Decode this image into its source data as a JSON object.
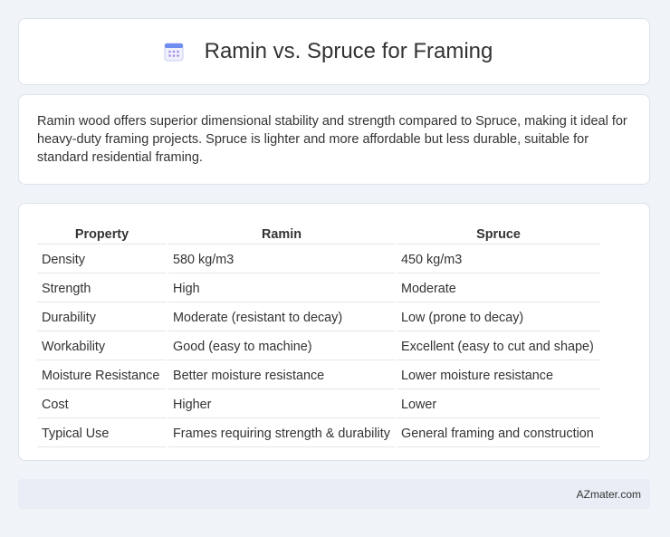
{
  "header": {
    "title": "Ramin vs. Spruce for Framing",
    "icon": "calendar-icon"
  },
  "summary": {
    "text": "Ramin wood offers superior dimensional stability and strength compared to Spruce, making it ideal for heavy-duty framing projects. Spruce is lighter and more affordable but less durable, suitable for standard residential framing."
  },
  "table": {
    "columns": [
      "Property",
      "Ramin",
      "Spruce"
    ],
    "rows": [
      [
        "Density",
        "580 kg/m3",
        "450 kg/m3"
      ],
      [
        "Strength",
        "High",
        "Moderate"
      ],
      [
        "Durability",
        "Moderate (resistant to decay)",
        "Low (prone to decay)"
      ],
      [
        "Workability",
        "Good (easy to machine)",
        "Excellent (easy to cut and shape)"
      ],
      [
        "Moisture Resistance",
        "Better moisture resistance",
        "Lower moisture resistance"
      ],
      [
        "Cost",
        "Higher",
        "Lower"
      ],
      [
        "Typical Use",
        "Frames requiring strength & durability",
        "General framing and construction"
      ]
    ]
  },
  "footer": {
    "source": "AZmater.com"
  }
}
